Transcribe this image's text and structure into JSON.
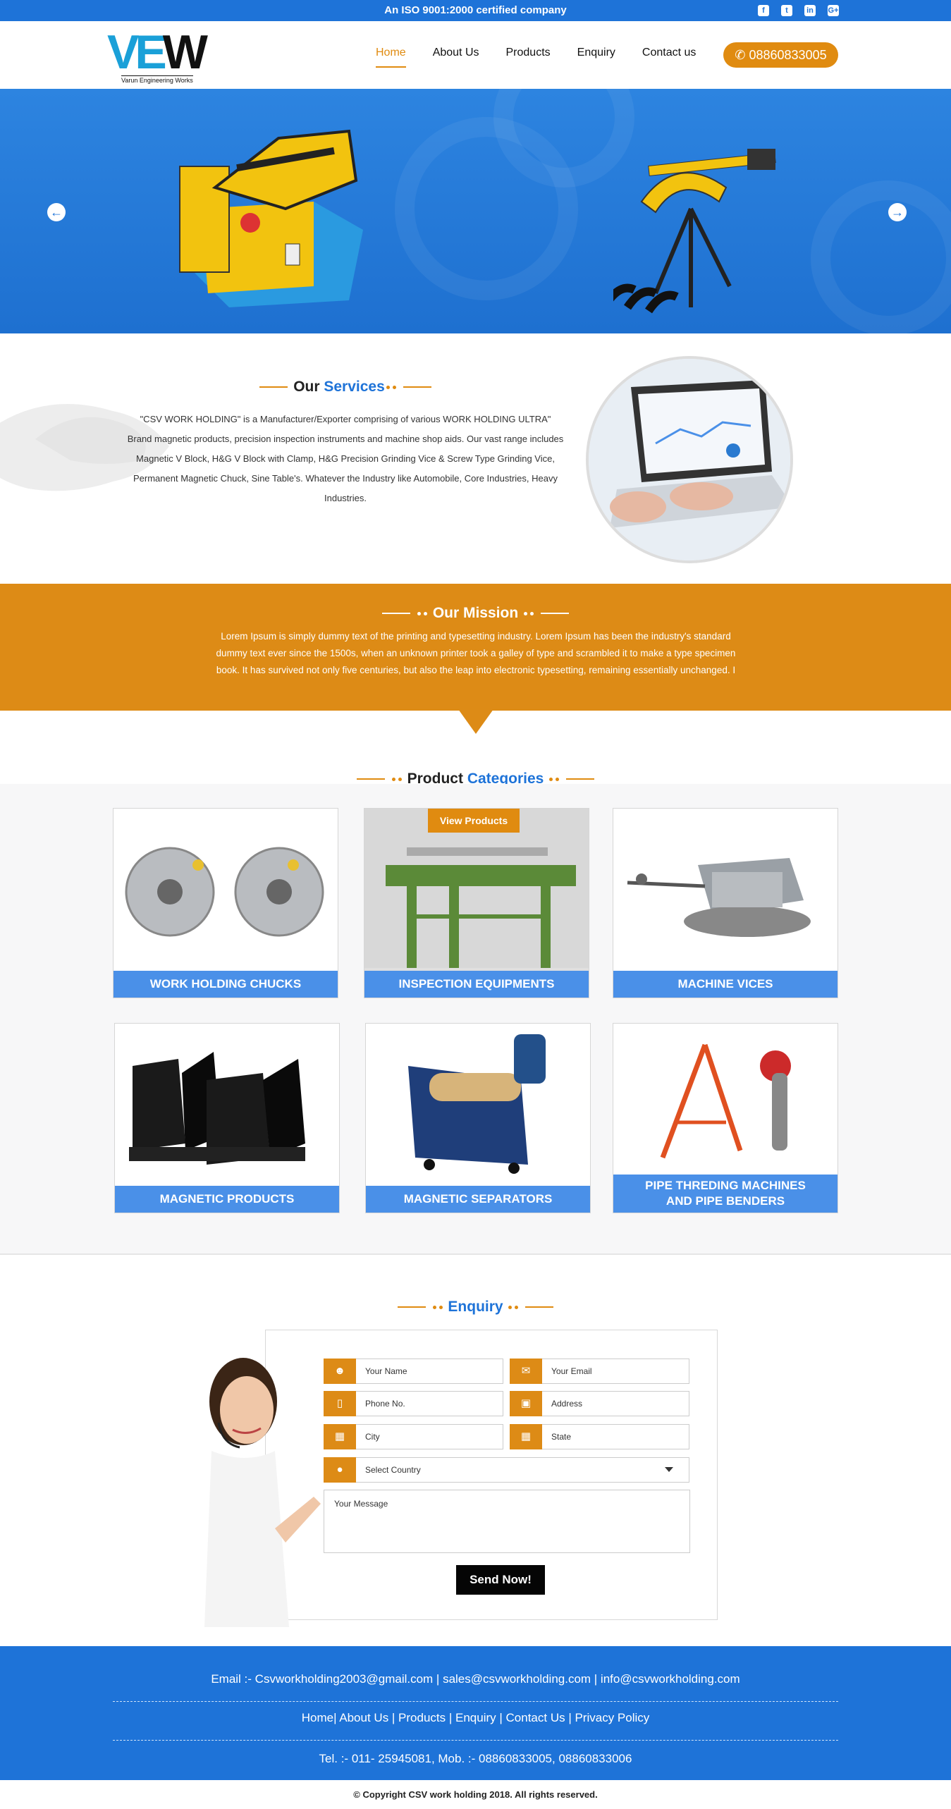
{
  "topbar": {
    "certification": "An ISO 9001:2000 certified company",
    "social": [
      {
        "icon": "facebook-icon",
        "glyph": "f"
      },
      {
        "icon": "twitter-icon",
        "glyph": "t"
      },
      {
        "icon": "linkedin-icon",
        "glyph": "in"
      },
      {
        "icon": "google-plus-icon",
        "glyph": "G+"
      }
    ]
  },
  "header": {
    "logo_letters": "VEW",
    "logo_tagline": "Varun Engineering Works",
    "nav": [
      "Home",
      "About Us",
      "Products",
      "Enquiry",
      "Contact us"
    ],
    "active_nav": "Home",
    "phone": "08860833005"
  },
  "services": {
    "title_a": "Our",
    "title_b": "Services",
    "text": "\"CSV WORK HOLDING\" is a Manufacturer/Exporter comprising of various WORK HOLDING ULTRA\" Brand magnetic products, precision inspection instruments and machine shop aids. Our vast range includes Magnetic V Block, H&G V Block with Clamp, H&G Precision Grinding Vice & Screw Type Grinding Vice, Permanent Magnetic Chuck, Sine Table's. Whatever the Industry like Automobile, Core Industries, Heavy Industries."
  },
  "mission": {
    "title": "Our Mission",
    "text": "Lorem Ipsum is simply dummy text of the printing and typesetting industry. Lorem Ipsum has been the industry's standard dummy text ever since the 1500s, when an unknown printer took a galley of type and scrambled it to make a type specimen book. It has survived not only five centuries, but also the leap into electronic typesetting, remaining essentially unchanged. I"
  },
  "products": {
    "title_a": "Product",
    "title_b": "Categories",
    "view_button": "View Products",
    "items": [
      "WORK HOLDING CHUCKS",
      "INSPECTION EQUIPMENTS",
      "MACHINE VICES",
      "MAGNETIC PRODUCTS",
      "MAGNETIC SEPARATORS",
      "PIPE THREDING MACHINES AND PIPE BENDERS"
    ],
    "item_line1_6": "PIPE THREDING MACHINES",
    "item_line2_6": "AND PIPE BENDERS"
  },
  "enquiry": {
    "title": "Enquiry",
    "fields": {
      "name": "Your Name",
      "email": "Your Email",
      "phone": "Phone No.",
      "address": "Address",
      "city": "City",
      "state": "State",
      "country": "Select Country",
      "message": "Your Message"
    },
    "send": "Send Now!"
  },
  "footer": {
    "email_label": "Email :-",
    "emails": "Csvworkholding2003@gmail.com | sales@csvworkholding.com | info@csvworkholding.com",
    "links": "Home| About Us | Products | Enquiry | Contact Us | Privacy Policy",
    "phones": "Tel. :- 011- 25945081,  Mob. :- 08860833005, 08860833006",
    "copyright": "© Copyright CSV work holding 2018. All rights reserved."
  },
  "colors": {
    "primary_blue": "#1e73d8",
    "accent_orange": "#e08b10",
    "label_blue": "#4a90e8"
  }
}
